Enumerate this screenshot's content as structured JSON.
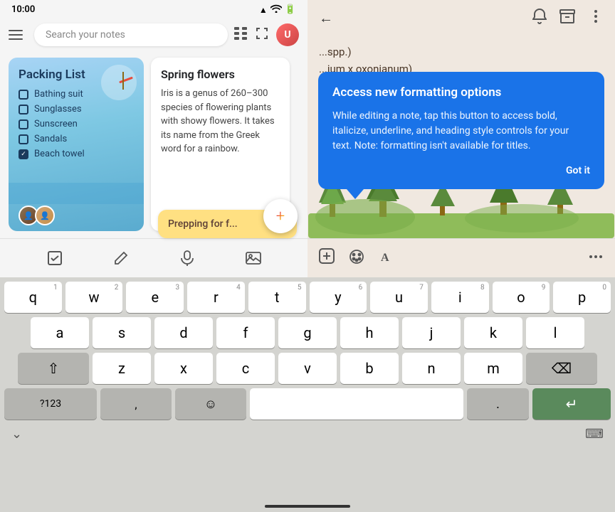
{
  "status_bar": {
    "time": "10:00",
    "signal": "▲▼",
    "wifi": "wifi",
    "battery": "battery"
  },
  "left_panel": {
    "search_placeholder": "Search your notes",
    "cards": [
      {
        "id": "packing",
        "title": "Packing List",
        "items": [
          {
            "label": "Bathing suit",
            "checked": false
          },
          {
            "label": "Sunglasses",
            "checked": false
          },
          {
            "label": "Sunscreen",
            "checked": false
          },
          {
            "label": "Sandals",
            "checked": false
          },
          {
            "label": "Beach towel",
            "checked": true
          }
        ]
      },
      {
        "id": "spring",
        "title": "Spring flowers",
        "text": "Iris is a genus of 260–300 species of flowering plants with showy flowers. It takes its name from the Greek word for a rainbow."
      }
    ],
    "prepping_card": {
      "title": "Prepping for f..."
    },
    "toolbar_icons": [
      "checkbox",
      "pencil",
      "microphone",
      "image"
    ]
  },
  "right_panel": {
    "note_partial_text": "spp.)\nium x oxonianum)",
    "toolbar_icons": [
      "bell",
      "archive",
      "alert"
    ],
    "bottom_icons": [
      "add",
      "palette",
      "format-text",
      "more"
    ],
    "tooltip": {
      "title": "Access new formatting options",
      "body": "While editing a note, tap this button to access bold, italicize, underline, and heading style controls for your text. Note: formatting isn't available for titles.",
      "action": "Got it"
    }
  },
  "keyboard": {
    "rows": [
      [
        "q",
        "w",
        "e",
        "r",
        "t",
        "y",
        "u",
        "i",
        "o",
        "p"
      ],
      [
        "a",
        "s",
        "d",
        "f",
        "g",
        "h",
        "j",
        "k",
        "l"
      ],
      [
        "z",
        "x",
        "c",
        "v",
        "b",
        "n",
        "m"
      ],
      []
    ],
    "numbers": {
      "q": "1",
      "w": "2",
      "e": "3",
      "r": "4",
      "t": "5",
      "y": "6",
      "u": "7",
      "i": "8",
      "o": "9",
      "p": "0"
    },
    "special_keys": {
      "shift": "⇧",
      "backspace": "⌫",
      "symbols": "?123",
      "comma": ",",
      "emoji": "☺",
      "space": "",
      "period": ".",
      "enter": "↵"
    },
    "bottom_bar": {
      "left_icon": "chevron-down",
      "right_icon": "keyboard-grid"
    }
  }
}
